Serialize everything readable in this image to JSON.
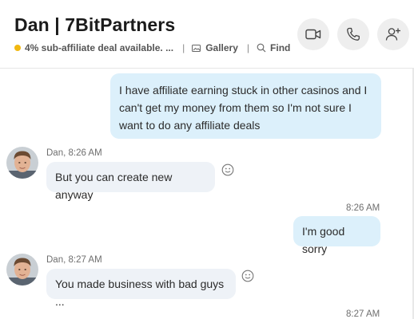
{
  "header": {
    "title": "Dan | 7BitPartners",
    "mood": "4% sub-affiliate deal available. ...",
    "separator": "|",
    "gallery_label": "Gallery",
    "find_label": "Find",
    "status_color": "#f1b811"
  },
  "messages": [
    {
      "direction": "outgoing",
      "text_lines": [
        "I have affiliate earning stuck in other casinos and I",
        "can't get my money from them so I'm not sure I",
        "want to do any affiliate deals"
      ]
    },
    {
      "direction": "incoming",
      "sender_time": "Dan, 8:26 AM",
      "text": "But you can create new anyway"
    },
    {
      "direction": "outgoing",
      "time": "8:26 AM",
      "text": "I'm good sorry"
    },
    {
      "direction": "incoming",
      "sender_time": "Dan, 8:27 AM",
      "text": "You made business with bad guys ..."
    },
    {
      "direction": "outgoing",
      "time": "8:27 AM"
    }
  ],
  "icons": {
    "video_call": "video-camera-icon",
    "audio_call": "phone-icon",
    "add_people": "add-person-icon",
    "gallery": "gallery-icon",
    "find": "search-icon",
    "reaction": "smiley-icon"
  },
  "colors": {
    "outgoing_bubble": "#dcf0fb",
    "incoming_bubble": "#eef2f7",
    "header_button": "#eeeeee"
  }
}
